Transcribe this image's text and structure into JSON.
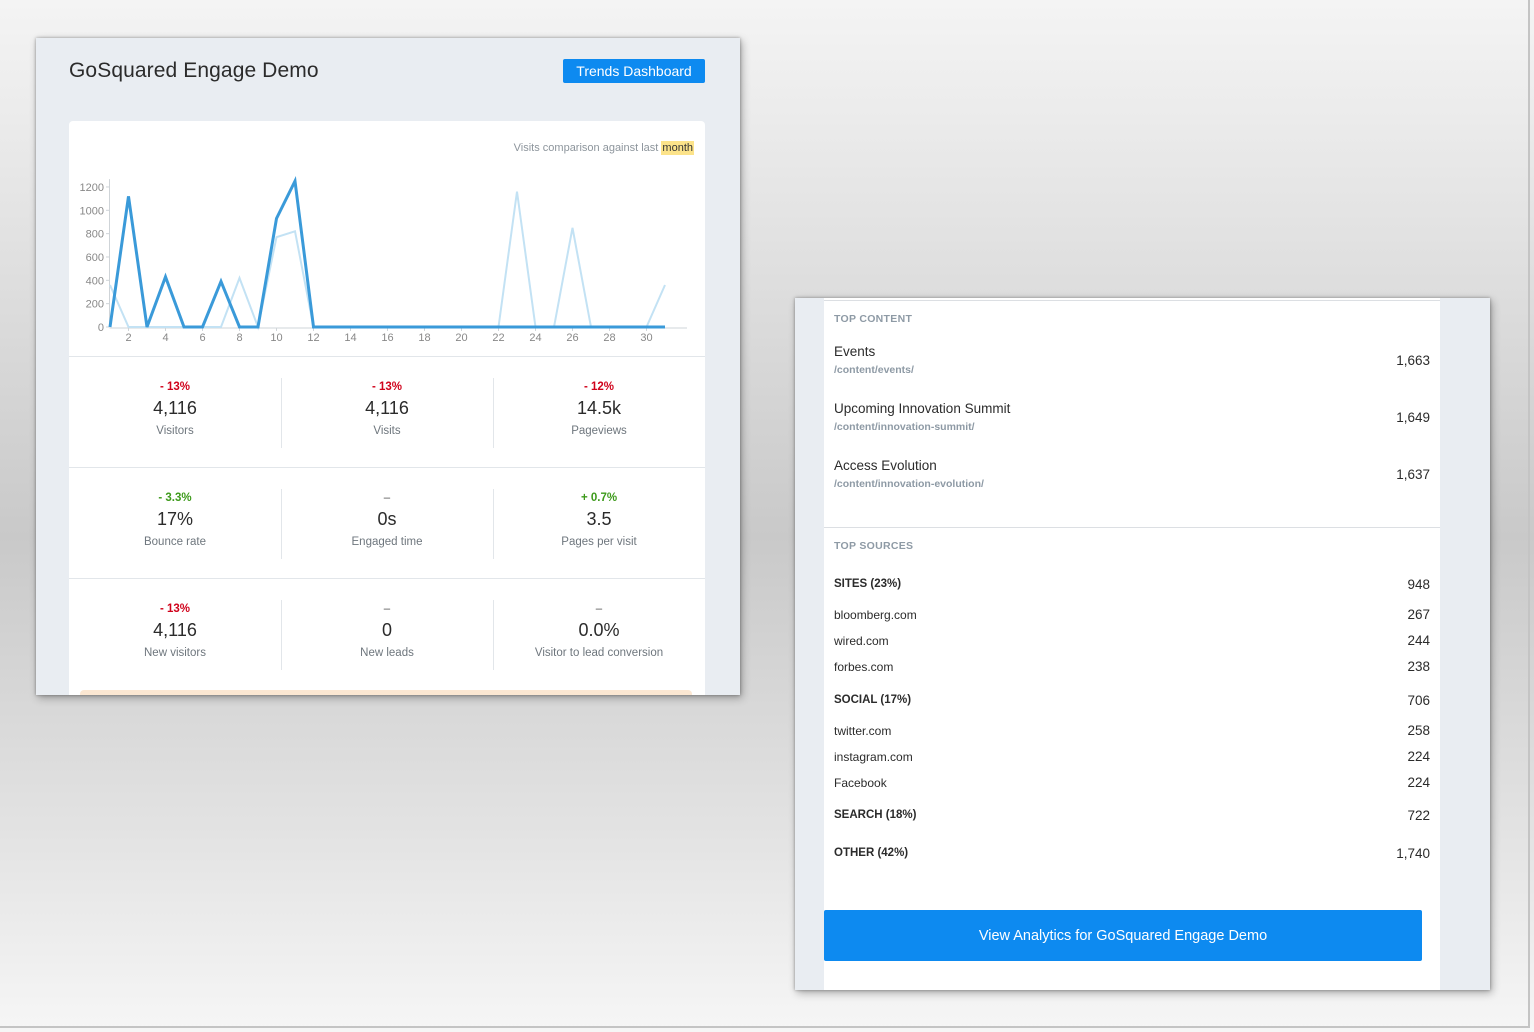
{
  "left_panel": {
    "title": "GoSquared Engage Demo",
    "trends_button": "Trends Dashboard",
    "chart_caption_prefix": "Visits comparison against last",
    "chart_caption_highlight": "month",
    "metrics": [
      [
        {
          "delta": "- 13%",
          "trend": "neg",
          "value": "4,116",
          "label": "Visitors"
        },
        {
          "delta": "- 13%",
          "trend": "neg",
          "value": "4,116",
          "label": "Visits"
        },
        {
          "delta": "- 12%",
          "trend": "neg",
          "value": "14.5k",
          "label": "Pageviews"
        }
      ],
      [
        {
          "delta": "- 3.3%",
          "trend": "pos",
          "value": "17%",
          "label": "Bounce rate"
        },
        {
          "delta": "–",
          "trend": "none",
          "value": "0s",
          "label": "Engaged time"
        },
        {
          "delta": "+ 0.7%",
          "trend": "pos",
          "value": "3.5",
          "label": "Pages per visit"
        }
      ],
      [
        {
          "delta": "- 13%",
          "trend": "neg",
          "value": "4,116",
          "label": "New visitors"
        },
        {
          "delta": "–",
          "trend": "none",
          "value": "0",
          "label": "New leads"
        },
        {
          "delta": "–",
          "trend": "none",
          "value": "0.0%",
          "label": "Visitor to lead conversion"
        }
      ]
    ]
  },
  "chart_data": {
    "type": "line",
    "title": "",
    "xlabel": "",
    "ylabel": "",
    "ylim": [
      0,
      1250
    ],
    "yticks": [
      0,
      200,
      400,
      600,
      800,
      1000,
      1200
    ],
    "xticks": [
      2,
      4,
      6,
      8,
      10,
      12,
      14,
      16,
      18,
      20,
      22,
      24,
      26,
      28,
      30
    ],
    "x": [
      1,
      2,
      3,
      4,
      5,
      6,
      7,
      8,
      9,
      10,
      11,
      12,
      13,
      14,
      15,
      16,
      17,
      18,
      19,
      20,
      21,
      22,
      23,
      24,
      25,
      26,
      27,
      28,
      29,
      30,
      31
    ],
    "series": [
      {
        "color": "#3a9ad9",
        "values": [
          0,
          1120,
          0,
          430,
          0,
          0,
          390,
          0,
          0,
          930,
          1250,
          0,
          0,
          0,
          0,
          0,
          0,
          0,
          0,
          0,
          0,
          0,
          0,
          0,
          0,
          0,
          0,
          0,
          0,
          0,
          0
        ]
      },
      {
        "color": "#c3e2f4",
        "values": [
          360,
          0,
          0,
          0,
          0,
          0,
          0,
          420,
          0,
          770,
          820,
          0,
          0,
          0,
          0,
          0,
          0,
          0,
          0,
          0,
          0,
          0,
          1160,
          0,
          0,
          850,
          0,
          0,
          0,
          0,
          360
        ]
      }
    ],
    "grid": false,
    "legend": "none"
  },
  "right_panel": {
    "top_content_title": "TOP CONTENT",
    "top_content": [
      {
        "title": "Events",
        "path": "/content/events/",
        "value": "1,663"
      },
      {
        "title": "Upcoming Innovation Summit",
        "path": "/content/innovation-summit/",
        "value": "1,649"
      },
      {
        "title": "Access Evolution",
        "path": "/content/innovation-evolution/",
        "value": "1,637"
      }
    ],
    "top_sources_title": "TOP SOURCES",
    "sources": [
      {
        "label": "SITES (23%)",
        "value": "948",
        "group": true
      },
      {
        "label": "bloomberg.com",
        "value": "267",
        "group": false
      },
      {
        "label": "wired.com",
        "value": "244",
        "group": false
      },
      {
        "label": "forbes.com",
        "value": "238",
        "group": false
      },
      {
        "label": "SOCIAL (17%)",
        "value": "706",
        "group": true
      },
      {
        "label": "twitter.com",
        "value": "258",
        "group": false
      },
      {
        "label": "instagram.com",
        "value": "224",
        "group": false
      },
      {
        "label": "Facebook",
        "value": "224",
        "group": false
      },
      {
        "label": "SEARCH (18%)",
        "value": "722",
        "group": true
      },
      {
        "label": "OTHER (42%)",
        "value": "1,740",
        "group": true
      }
    ],
    "view_button": "View Analytics for GoSquared Engage Demo"
  }
}
